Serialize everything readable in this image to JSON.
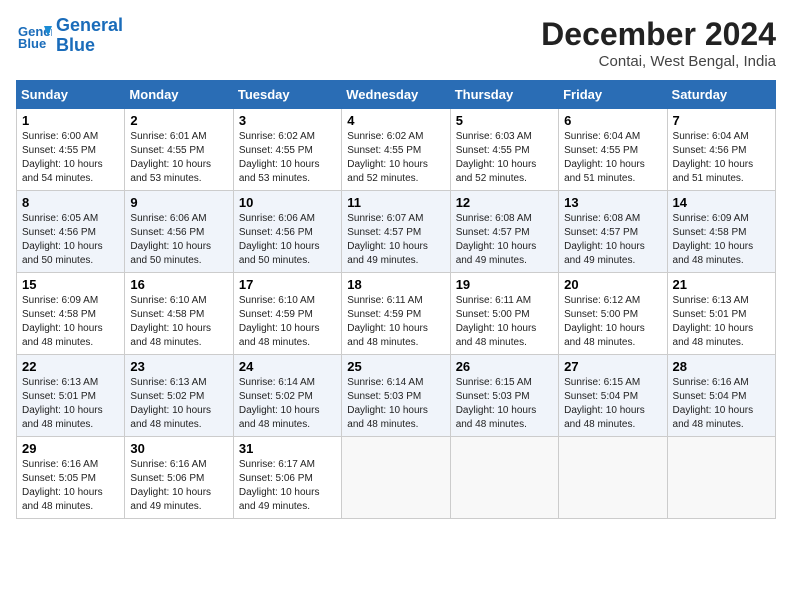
{
  "header": {
    "logo_line1": "General",
    "logo_line2": "Blue",
    "month_title": "December 2024",
    "location": "Contai, West Bengal, India"
  },
  "days_of_week": [
    "Sunday",
    "Monday",
    "Tuesday",
    "Wednesday",
    "Thursday",
    "Friday",
    "Saturday"
  ],
  "weeks": [
    [
      {
        "day": "1",
        "sunrise": "6:00 AM",
        "sunset": "4:55 PM",
        "daylight": "10 hours and 54 minutes."
      },
      {
        "day": "2",
        "sunrise": "6:01 AM",
        "sunset": "4:55 PM",
        "daylight": "10 hours and 53 minutes."
      },
      {
        "day": "3",
        "sunrise": "6:02 AM",
        "sunset": "4:55 PM",
        "daylight": "10 hours and 53 minutes."
      },
      {
        "day": "4",
        "sunrise": "6:02 AM",
        "sunset": "4:55 PM",
        "daylight": "10 hours and 52 minutes."
      },
      {
        "day": "5",
        "sunrise": "6:03 AM",
        "sunset": "4:55 PM",
        "daylight": "10 hours and 52 minutes."
      },
      {
        "day": "6",
        "sunrise": "6:04 AM",
        "sunset": "4:55 PM",
        "daylight": "10 hours and 51 minutes."
      },
      {
        "day": "7",
        "sunrise": "6:04 AM",
        "sunset": "4:56 PM",
        "daylight": "10 hours and 51 minutes."
      }
    ],
    [
      {
        "day": "8",
        "sunrise": "6:05 AM",
        "sunset": "4:56 PM",
        "daylight": "10 hours and 50 minutes."
      },
      {
        "day": "9",
        "sunrise": "6:06 AM",
        "sunset": "4:56 PM",
        "daylight": "10 hours and 50 minutes."
      },
      {
        "day": "10",
        "sunrise": "6:06 AM",
        "sunset": "4:56 PM",
        "daylight": "10 hours and 50 minutes."
      },
      {
        "day": "11",
        "sunrise": "6:07 AM",
        "sunset": "4:57 PM",
        "daylight": "10 hours and 49 minutes."
      },
      {
        "day": "12",
        "sunrise": "6:08 AM",
        "sunset": "4:57 PM",
        "daylight": "10 hours and 49 minutes."
      },
      {
        "day": "13",
        "sunrise": "6:08 AM",
        "sunset": "4:57 PM",
        "daylight": "10 hours and 49 minutes."
      },
      {
        "day": "14",
        "sunrise": "6:09 AM",
        "sunset": "4:58 PM",
        "daylight": "10 hours and 48 minutes."
      }
    ],
    [
      {
        "day": "15",
        "sunrise": "6:09 AM",
        "sunset": "4:58 PM",
        "daylight": "10 hours and 48 minutes."
      },
      {
        "day": "16",
        "sunrise": "6:10 AM",
        "sunset": "4:58 PM",
        "daylight": "10 hours and 48 minutes."
      },
      {
        "day": "17",
        "sunrise": "6:10 AM",
        "sunset": "4:59 PM",
        "daylight": "10 hours and 48 minutes."
      },
      {
        "day": "18",
        "sunrise": "6:11 AM",
        "sunset": "4:59 PM",
        "daylight": "10 hours and 48 minutes."
      },
      {
        "day": "19",
        "sunrise": "6:11 AM",
        "sunset": "5:00 PM",
        "daylight": "10 hours and 48 minutes."
      },
      {
        "day": "20",
        "sunrise": "6:12 AM",
        "sunset": "5:00 PM",
        "daylight": "10 hours and 48 minutes."
      },
      {
        "day": "21",
        "sunrise": "6:13 AM",
        "sunset": "5:01 PM",
        "daylight": "10 hours and 48 minutes."
      }
    ],
    [
      {
        "day": "22",
        "sunrise": "6:13 AM",
        "sunset": "5:01 PM",
        "daylight": "10 hours and 48 minutes."
      },
      {
        "day": "23",
        "sunrise": "6:13 AM",
        "sunset": "5:02 PM",
        "daylight": "10 hours and 48 minutes."
      },
      {
        "day": "24",
        "sunrise": "6:14 AM",
        "sunset": "5:02 PM",
        "daylight": "10 hours and 48 minutes."
      },
      {
        "day": "25",
        "sunrise": "6:14 AM",
        "sunset": "5:03 PM",
        "daylight": "10 hours and 48 minutes."
      },
      {
        "day": "26",
        "sunrise": "6:15 AM",
        "sunset": "5:03 PM",
        "daylight": "10 hours and 48 minutes."
      },
      {
        "day": "27",
        "sunrise": "6:15 AM",
        "sunset": "5:04 PM",
        "daylight": "10 hours and 48 minutes."
      },
      {
        "day": "28",
        "sunrise": "6:16 AM",
        "sunset": "5:04 PM",
        "daylight": "10 hours and 48 minutes."
      }
    ],
    [
      {
        "day": "29",
        "sunrise": "6:16 AM",
        "sunset": "5:05 PM",
        "daylight": "10 hours and 48 minutes."
      },
      {
        "day": "30",
        "sunrise": "6:16 AM",
        "sunset": "5:06 PM",
        "daylight": "10 hours and 49 minutes."
      },
      {
        "day": "31",
        "sunrise": "6:17 AM",
        "sunset": "5:06 PM",
        "daylight": "10 hours and 49 minutes."
      },
      null,
      null,
      null,
      null
    ]
  ],
  "labels": {
    "sunrise": "Sunrise:",
    "sunset": "Sunset:",
    "daylight": "Daylight:"
  }
}
